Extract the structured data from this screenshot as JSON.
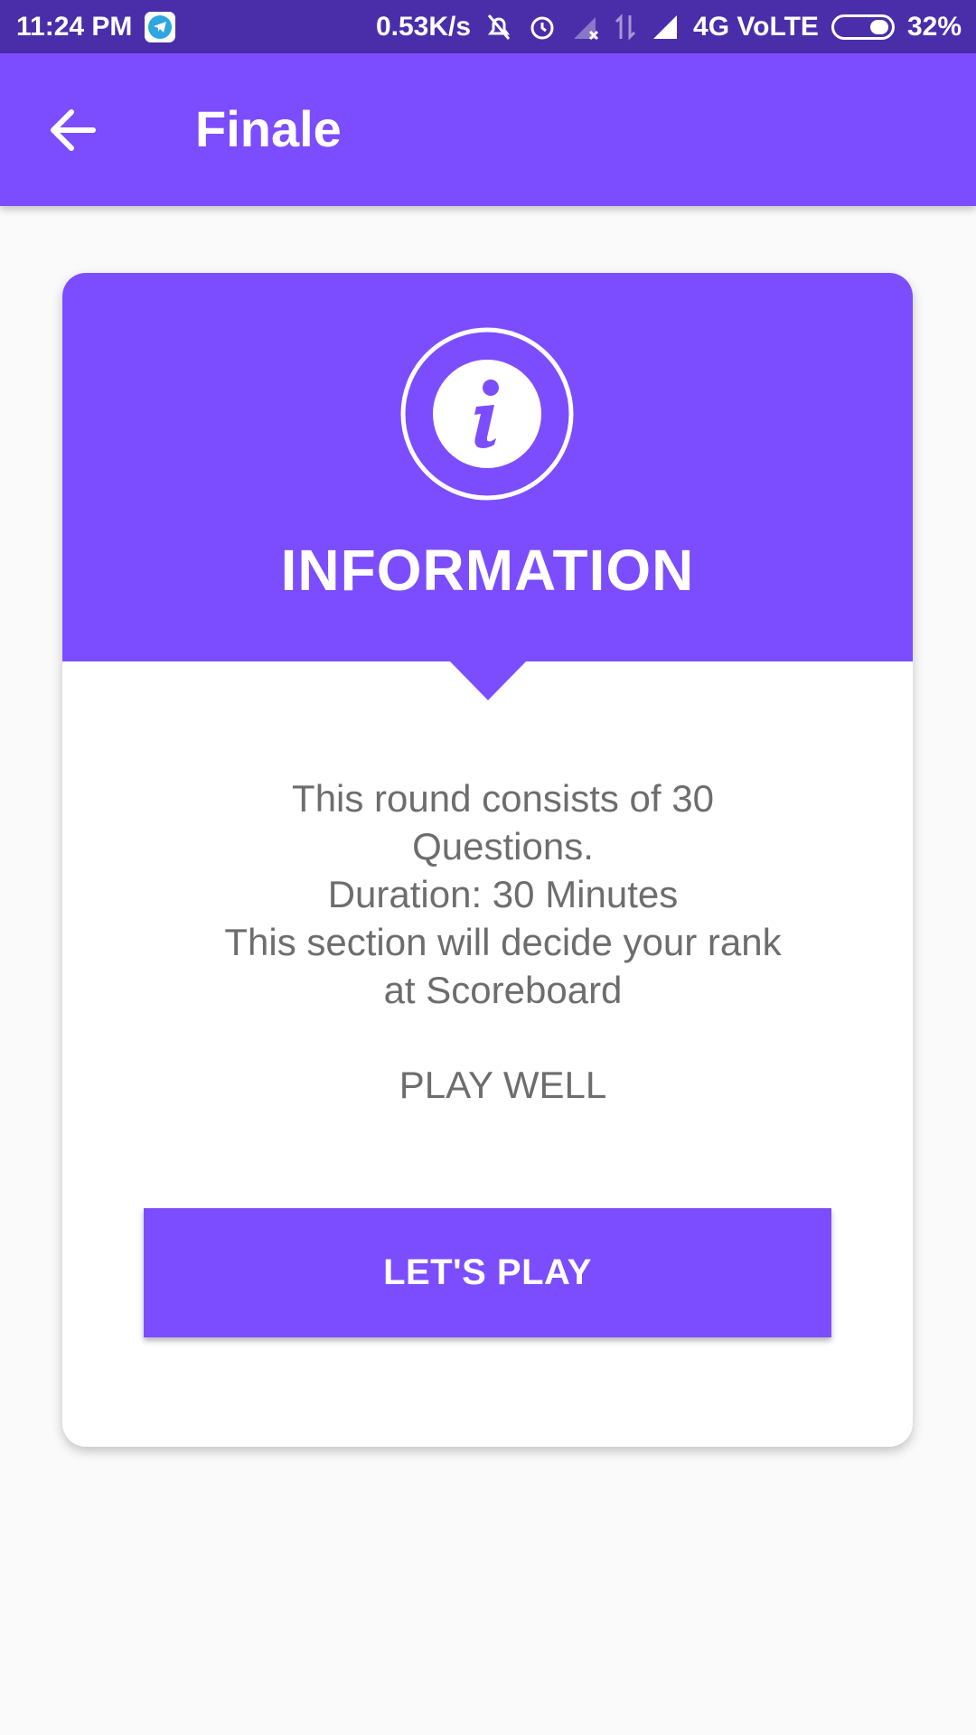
{
  "status_bar": {
    "time": "11:24 PM",
    "speed": "0.53K/s",
    "network": "4G VoLTE",
    "battery": "32%",
    "battery_level": 0.32,
    "icons": [
      "telegram-icon",
      "mute-icon",
      "alarm-icon",
      "signal-off-icon",
      "data-arrows-icon",
      "signal-icon",
      "battery-icon"
    ]
  },
  "app_bar": {
    "title": "Finale",
    "back_icon": "arrow-back-icon"
  },
  "card": {
    "icon": "info-icon",
    "heading": "INFORMATION",
    "body_lines": [
      "This round consists of 30",
      "Questions.",
      "Duration: 30 Minutes",
      "This section will decide your rank",
      "at Scoreboard"
    ],
    "footer": "PLAY WELL",
    "button_label": "LET'S PLAY"
  },
  "colors": {
    "status_bar": "#4a2ea9",
    "primary": "#7c4dff",
    "background": "#fafafa",
    "body_text": "#6d6d6d"
  }
}
